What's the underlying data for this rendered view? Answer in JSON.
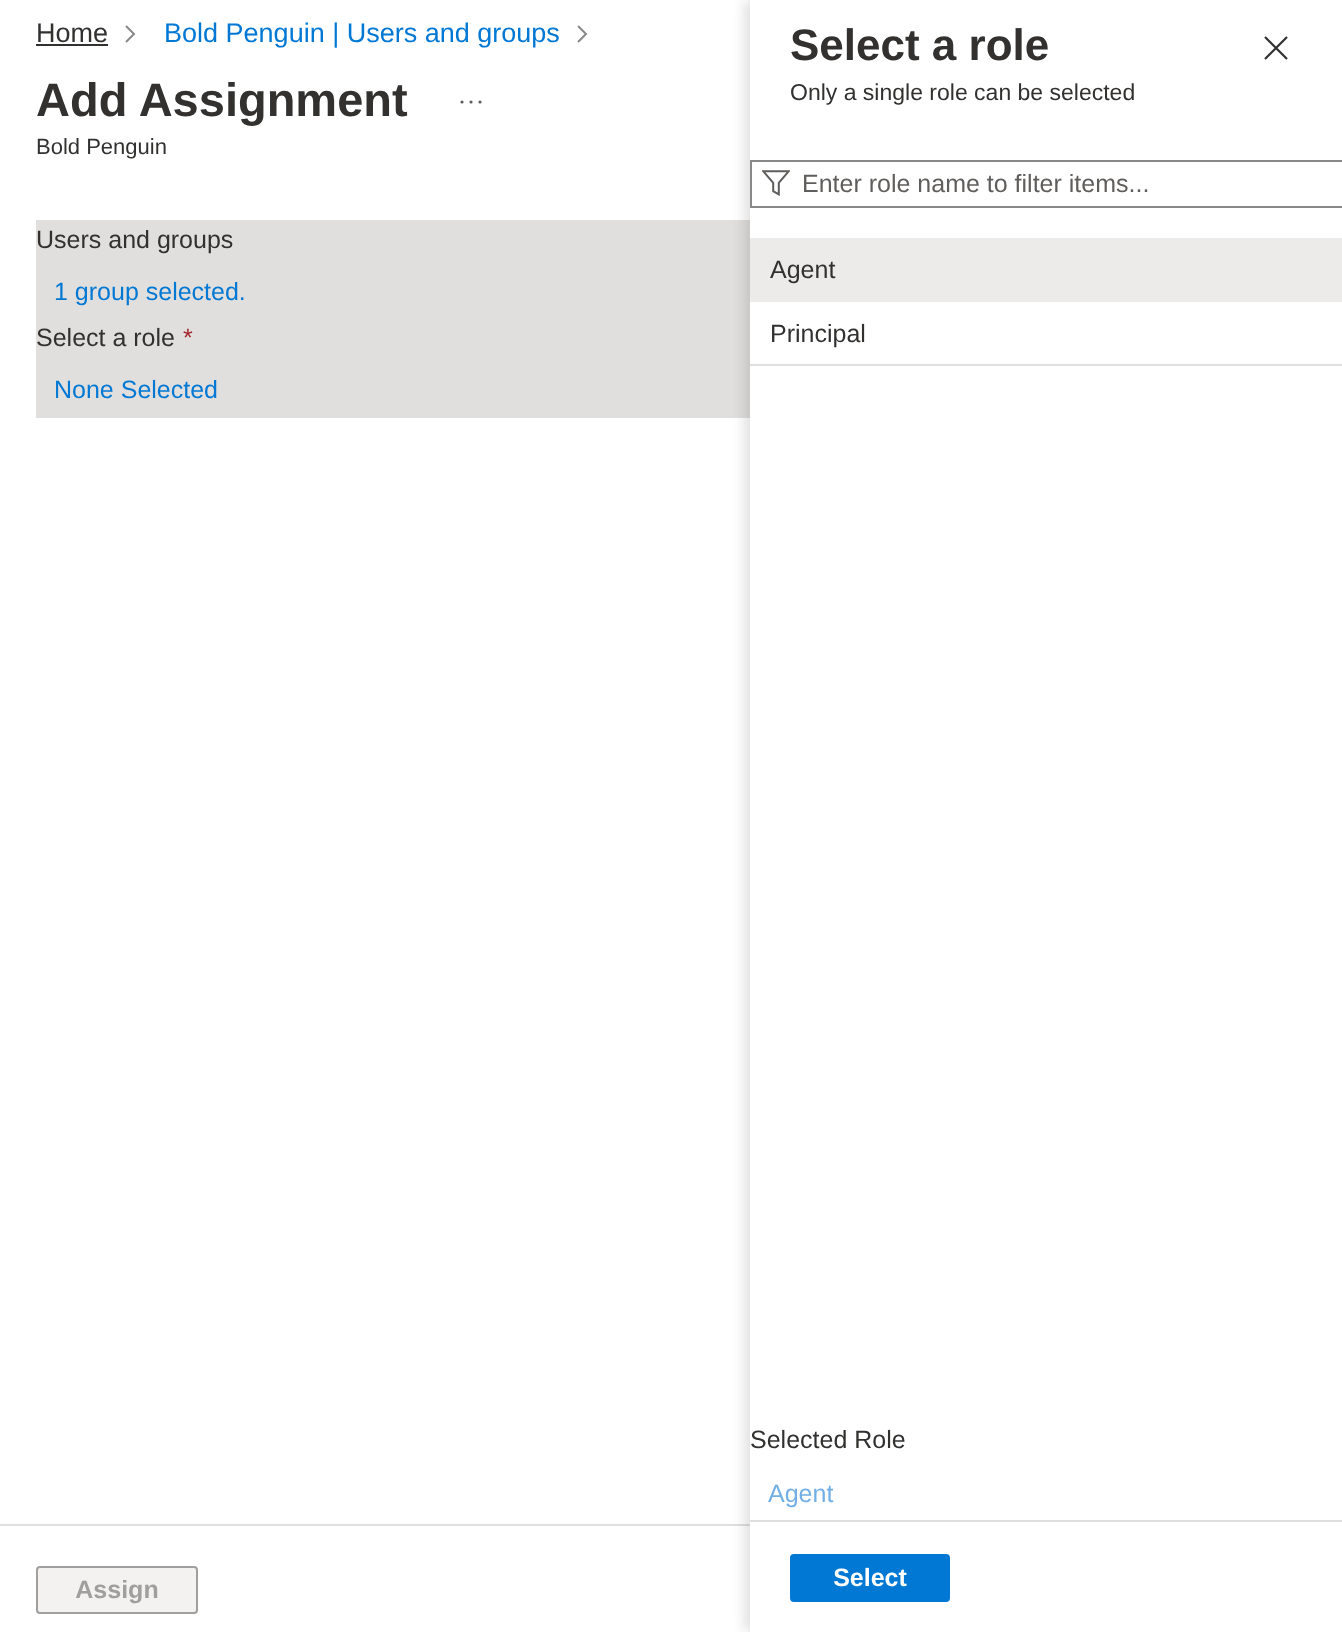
{
  "breadcrumb": [
    {
      "label": "Home",
      "hovered": true
    },
    {
      "label": "Bold Penguin | Users and groups",
      "hovered": false
    }
  ],
  "page": {
    "title": "Add Assignment",
    "subtitle": "Bold Penguin"
  },
  "form": {
    "fields": [
      {
        "label": "Users and groups",
        "value": "1 group selected."
      },
      {
        "label": "Select a role",
        "required_mark": "*",
        "value": "None Selected"
      }
    ]
  },
  "assign_button": {
    "label": "Assign",
    "disabled": true
  },
  "panel": {
    "title": "Select a role",
    "subtitle": "Only a single role can be selected",
    "filter": {
      "placeholder": "Enter role name to filter items..."
    },
    "roles": [
      {
        "label": "Agent",
        "selected": true
      },
      {
        "label": "Principal",
        "selected": false
      }
    ],
    "selected_role": {
      "label": "Selected Role",
      "value": "Agent"
    },
    "select_button": {
      "label": "Select",
      "disabled": false
    }
  }
}
